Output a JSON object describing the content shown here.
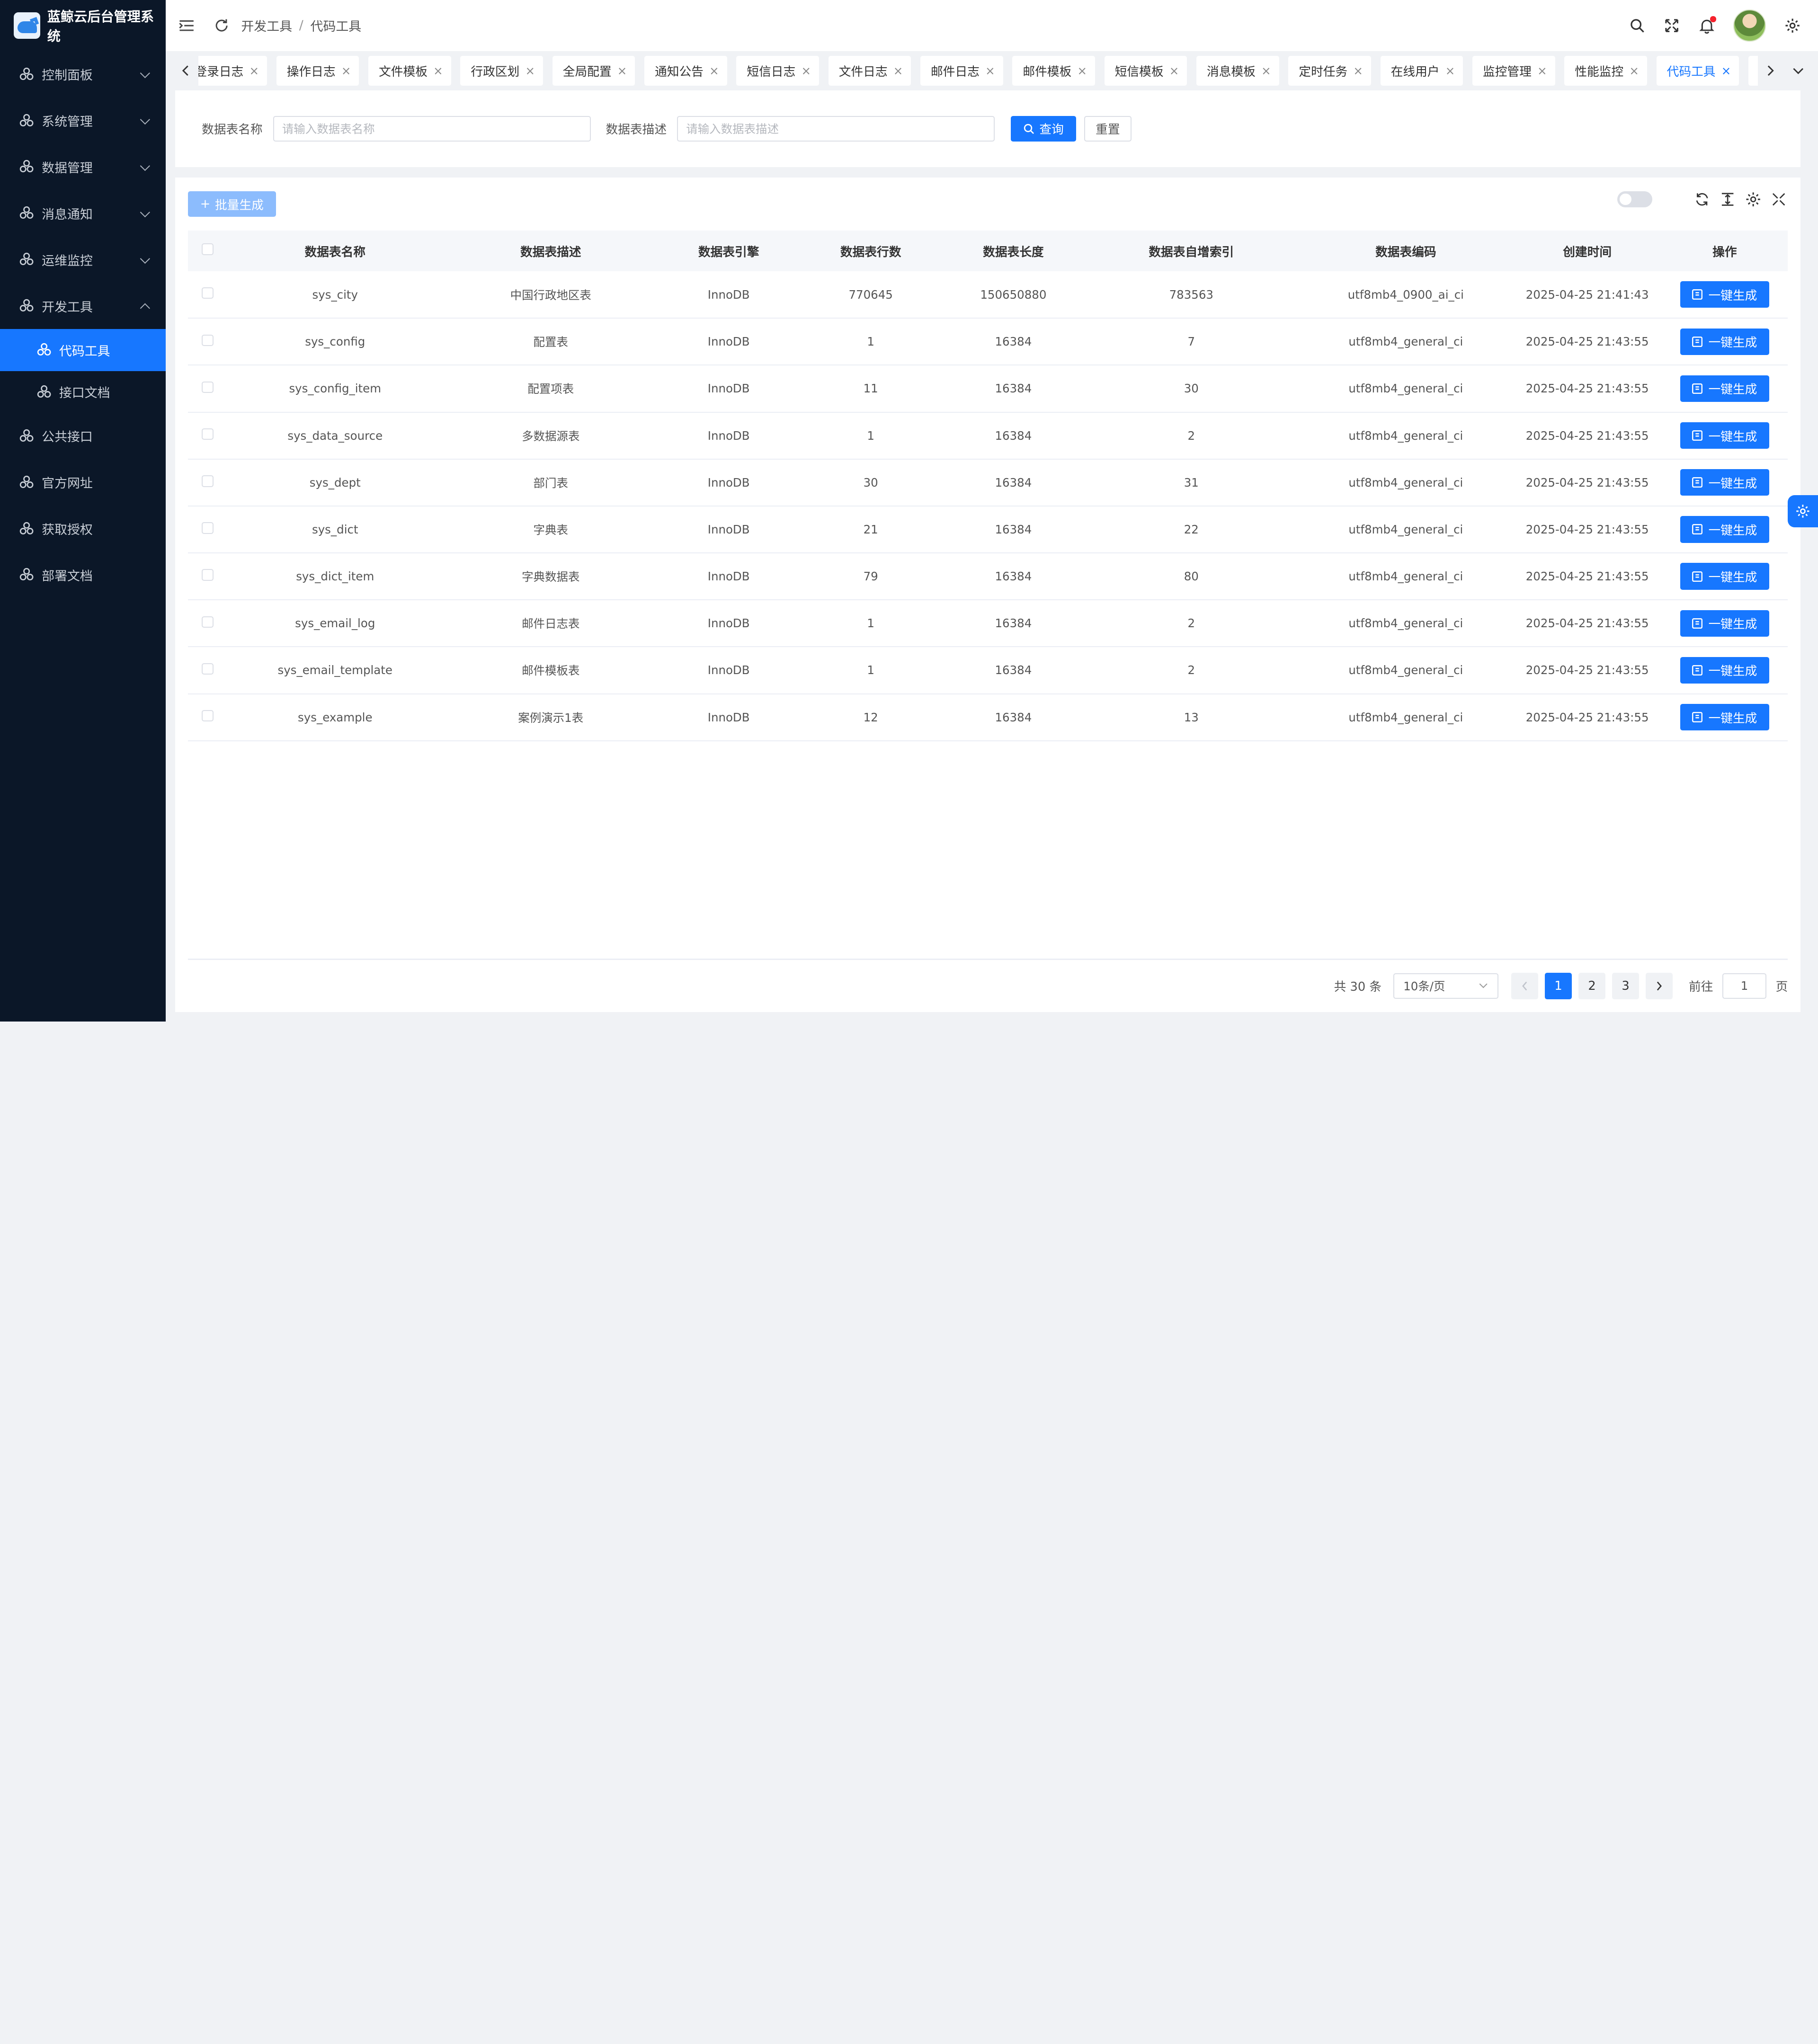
{
  "app": {
    "title": "蓝鲸云后台管理系统"
  },
  "sidebar": {
    "items": [
      {
        "label": "控制面板",
        "expanded": false
      },
      {
        "label": "系统管理",
        "expanded": false
      },
      {
        "label": "数据管理",
        "expanded": false
      },
      {
        "label": "消息通知",
        "expanded": false
      },
      {
        "label": "运维监控",
        "expanded": false
      },
      {
        "label": "开发工具",
        "expanded": true,
        "children": [
          {
            "label": "代码工具",
            "active": true
          },
          {
            "label": "接口文档",
            "active": false
          }
        ]
      },
      {
        "label": "公共接口"
      },
      {
        "label": "官方网址"
      },
      {
        "label": "获取授权"
      },
      {
        "label": "部署文档"
      }
    ]
  },
  "breadcrumb": [
    "开发工具",
    "代码工具"
  ],
  "tabs": [
    {
      "label": "登录日志",
      "active": false
    },
    {
      "label": "操作日志",
      "active": false
    },
    {
      "label": "文件模板",
      "active": false
    },
    {
      "label": "行政区划",
      "active": false
    },
    {
      "label": "全局配置",
      "active": false
    },
    {
      "label": "通知公告",
      "active": false
    },
    {
      "label": "短信日志",
      "active": false
    },
    {
      "label": "文件日志",
      "active": false
    },
    {
      "label": "邮件日志",
      "active": false
    },
    {
      "label": "邮件模板",
      "active": false
    },
    {
      "label": "短信模板",
      "active": false
    },
    {
      "label": "消息模板",
      "active": false
    },
    {
      "label": "定时任务",
      "active": false
    },
    {
      "label": "在线用户",
      "active": false
    },
    {
      "label": "监控管理",
      "active": false
    },
    {
      "label": "性能监控",
      "active": false
    },
    {
      "label": "代码工具",
      "active": true
    }
  ],
  "search": {
    "name_label": "数据表名称",
    "name_placeholder": "请输入数据表名称",
    "desc_label": "数据表描述",
    "desc_placeholder": "请输入数据表描述",
    "query_label": "查询",
    "reset_label": "重置"
  },
  "toolbar": {
    "batch_label": "批量生成"
  },
  "table": {
    "headers": [
      "数据表名称",
      "数据表描述",
      "数据表引擎",
      "数据表行数",
      "数据表长度",
      "数据表自增索引",
      "数据表编码",
      "创建时间",
      "操作"
    ],
    "action_label": "一键生成",
    "rows": [
      [
        "sys_city",
        "中国行政地区表",
        "InnoDB",
        "770645",
        "150650880",
        "783563",
        "utf8mb4_0900_ai_ci",
        "2025-04-25 21:41:43"
      ],
      [
        "sys_config",
        "配置表",
        "InnoDB",
        "1",
        "16384",
        "7",
        "utf8mb4_general_ci",
        "2025-04-25 21:43:55"
      ],
      [
        "sys_config_item",
        "配置项表",
        "InnoDB",
        "11",
        "16384",
        "30",
        "utf8mb4_general_ci",
        "2025-04-25 21:43:55"
      ],
      [
        "sys_data_source",
        "多数据源表",
        "InnoDB",
        "1",
        "16384",
        "2",
        "utf8mb4_general_ci",
        "2025-04-25 21:43:55"
      ],
      [
        "sys_dept",
        "部门表",
        "InnoDB",
        "30",
        "16384",
        "31",
        "utf8mb4_general_ci",
        "2025-04-25 21:43:55"
      ],
      [
        "sys_dict",
        "字典表",
        "InnoDB",
        "21",
        "16384",
        "22",
        "utf8mb4_general_ci",
        "2025-04-25 21:43:55"
      ],
      [
        "sys_dict_item",
        "字典数据表",
        "InnoDB",
        "79",
        "16384",
        "80",
        "utf8mb4_general_ci",
        "2025-04-25 21:43:55"
      ],
      [
        "sys_email_log",
        "邮件日志表",
        "InnoDB",
        "1",
        "16384",
        "2",
        "utf8mb4_general_ci",
        "2025-04-25 21:43:55"
      ],
      [
        "sys_email_template",
        "邮件模板表",
        "InnoDB",
        "1",
        "16384",
        "2",
        "utf8mb4_general_ci",
        "2025-04-25 21:43:55"
      ],
      [
        "sys_example",
        "案例演示1表",
        "InnoDB",
        "12",
        "16384",
        "13",
        "utf8mb4_general_ci",
        "2025-04-25 21:43:55"
      ]
    ]
  },
  "pagination": {
    "total_text": "共 30 条",
    "page_size": "10条/页",
    "pages": [
      "1",
      "2",
      "3"
    ],
    "current": "1",
    "jump_prefix": "前往",
    "jump_value": "1",
    "jump_suffix": "页"
  },
  "colors": {
    "primary": "#1777ff",
    "sidebar_bg": "#0b1728"
  }
}
